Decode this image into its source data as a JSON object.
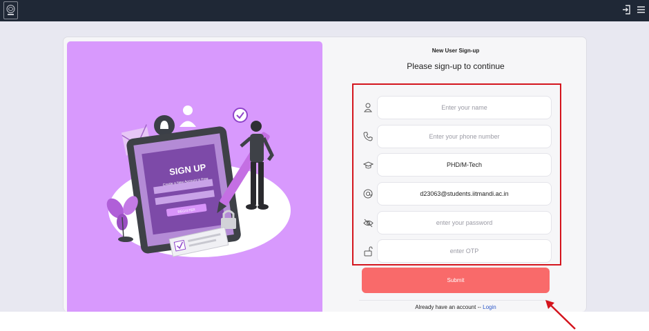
{
  "topbar": {
    "logo_icon": "institute-seal-icon",
    "login_icon": "sign-in-icon",
    "menu_icon": "hamburger-menu-icon"
  },
  "illustration": {
    "sign_up_title": "SIGN UP",
    "sign_up_subtitle": "Create a New Account is Free",
    "register_label": "REGISTER",
    "bg_color": "#d899fd"
  },
  "form": {
    "subtitle": "New User Sign-up",
    "headline": "Please sign-up to continue",
    "name_placeholder": "Enter your name",
    "phone_placeholder": "Enter your phone number",
    "program_value": "PHD/M-Tech",
    "email_value": "d23063@students.iitmandi.ac.in",
    "password_placeholder": "enter your password",
    "otp_placeholder": "enter OTP",
    "submit_label": "Submit",
    "login_prompt": "Already have an account --",
    "login_link": "Login"
  },
  "colors": {
    "topbar": "#1f2836",
    "submit": "#f96a6a",
    "highlight": "#d4141d",
    "link": "#2e58c8"
  }
}
